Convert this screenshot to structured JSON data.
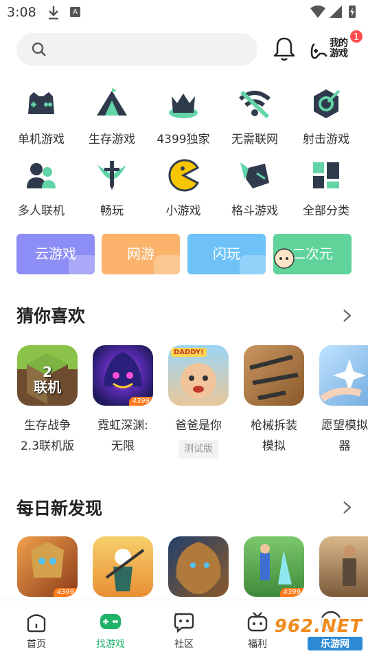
{
  "status": {
    "time": "3:08",
    "a_label": "A"
  },
  "header": {
    "search_placeholder": "",
    "my_game_label": "我的游戏",
    "notification_count": "1"
  },
  "categories": [
    {
      "label": "单机游戏",
      "icon": "gamepad-icon"
    },
    {
      "label": "生存游戏",
      "icon": "tent-icon"
    },
    {
      "label": "4399独家",
      "icon": "crown-icon"
    },
    {
      "label": "无需联网",
      "icon": "wifi-off-icon"
    },
    {
      "label": "射击游戏",
      "icon": "target-icon"
    },
    {
      "label": "多人联机",
      "icon": "multiplayer-icon"
    },
    {
      "label": "畅玩",
      "icon": "sword-icon"
    },
    {
      "label": "小游戏",
      "icon": "pacman-icon"
    },
    {
      "label": "格斗游戏",
      "icon": "fight-icon"
    },
    {
      "label": "全部分类",
      "icon": "grid-icon"
    }
  ],
  "tiles": [
    {
      "label": "云游戏",
      "color": "#8d8df6"
    },
    {
      "label": "网游",
      "color": "#fbb36c"
    },
    {
      "label": "闪玩",
      "color": "#6ec2f7"
    },
    {
      "label": "二次元",
      "color": "#5fd39a"
    }
  ],
  "guess": {
    "title": "猜你喜欢",
    "games": [
      {
        "name": "生存战争\n2.3联机版",
        "art_text": "2\n联机",
        "tag": ""
      },
      {
        "name": "霓虹深渊:\n无限",
        "art_text": "",
        "tag": "",
        "corner": "4399"
      },
      {
        "name": "爸爸是你",
        "art_text": "DADDY!",
        "tag": "测试版"
      },
      {
        "name": "枪械拆装\n模拟",
        "art_text": "",
        "tag": ""
      },
      {
        "name": "愿望模拟\n器",
        "art_text": "",
        "tag": ""
      }
    ]
  },
  "daily": {
    "title": "每日新发现",
    "corners": [
      "4399",
      "",
      "",
      "4399",
      ""
    ]
  },
  "nav": [
    {
      "label": "首页",
      "icon": "home-icon"
    },
    {
      "label": "找游戏",
      "icon": "find-game-icon"
    },
    {
      "label": "社区",
      "icon": "community-icon"
    },
    {
      "label": "福利",
      "icon": "gift-icon"
    },
    {
      "label": "",
      "icon": "more-icon"
    }
  ],
  "watermark": {
    "site": "962.NET",
    "sub": "乐游网"
  },
  "colors": {
    "accent": "#20b26b",
    "icon_dark": "#2f3b4c",
    "icon_green": "#63d4a8",
    "badge": "#ff4d4f"
  }
}
